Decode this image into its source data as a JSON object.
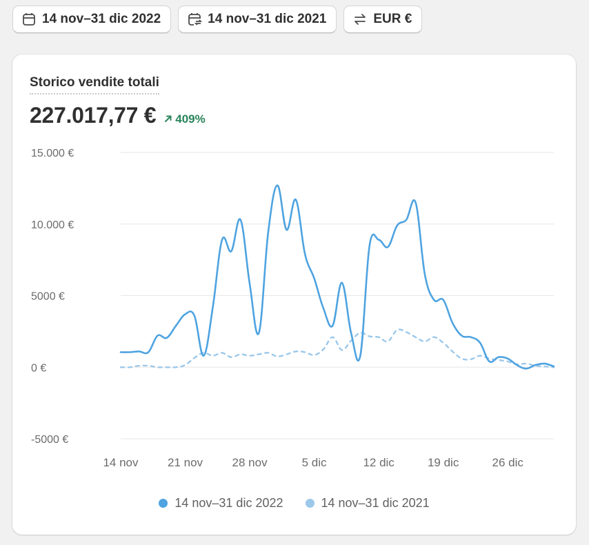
{
  "toolbar": {
    "date_range": "14 nov–31 dic 2022",
    "compare_range": "14 nov–31 dic 2021",
    "currency": "EUR €"
  },
  "card": {
    "title": "Storico vendite totali",
    "total": "227.017,77 €",
    "change": "409%"
  },
  "colors": {
    "primary": "#4ea3e0",
    "comparison": "#9cc8ea",
    "positive": "#29845a"
  },
  "chart_data": {
    "type": "line",
    "x_tick_labels": [
      "14 nov",
      "21 nov",
      "28 nov",
      "5 dic",
      "12 dic",
      "19 dic",
      "26 dic"
    ],
    "y_tick_labels": [
      "15.000 €",
      "10.000 €",
      "5000 €",
      "0 €",
      "-5000 €"
    ],
    "y_ticks": [
      15000,
      10000,
      5000,
      0,
      -5000
    ],
    "ylim": [
      -5000,
      15000
    ],
    "xlim": [
      0,
      47
    ],
    "grid": true,
    "legend_position": "bottom-center",
    "series": [
      {
        "name": "14 nov–31 dic 2022",
        "style": "solid",
        "x": [
          0,
          1,
          2,
          3,
          4,
          5,
          6,
          7,
          8,
          9,
          10,
          11,
          12,
          13,
          14,
          15,
          16,
          17,
          18,
          19,
          20,
          21,
          22,
          23,
          24,
          25,
          26,
          27,
          28,
          29,
          30,
          31,
          32,
          33,
          34,
          35,
          36,
          37,
          38,
          39,
          40,
          41,
          42,
          43,
          44,
          45,
          46,
          47
        ],
        "values": [
          1050,
          1050,
          1100,
          1050,
          2200,
          2050,
          2900,
          3700,
          3600,
          800,
          4200,
          8900,
          8100,
          10300,
          5800,
          2400,
          9400,
          12700,
          9600,
          11700,
          7900,
          6200,
          4100,
          2900,
          5900,
          2400,
          800,
          8500,
          8900,
          8400,
          9900,
          10300,
          11500,
          6500,
          4700,
          4700,
          3100,
          2200,
          2100,
          1700,
          400,
          700,
          600,
          150,
          -100,
          150,
          250,
          50
        ]
      },
      {
        "name": "14 nov–31 dic 2021",
        "style": "dashed",
        "x": [
          0,
          1,
          2,
          3,
          4,
          5,
          6,
          7,
          8,
          9,
          10,
          11,
          12,
          13,
          14,
          15,
          16,
          17,
          18,
          19,
          20,
          21,
          22,
          23,
          24,
          25,
          26,
          27,
          28,
          29,
          30,
          31,
          32,
          33,
          34,
          35,
          36,
          37,
          38,
          39,
          40,
          41,
          42,
          43,
          44,
          45,
          46,
          47
        ],
        "values": [
          0,
          0,
          100,
          100,
          0,
          0,
          0,
          150,
          650,
          1000,
          800,
          1000,
          700,
          900,
          800,
          900,
          1000,
          750,
          900,
          1100,
          1050,
          850,
          1250,
          2100,
          1200,
          1850,
          2400,
          2150,
          2100,
          1800,
          2600,
          2450,
          2100,
          1800,
          2100,
          1700,
          1100,
          600,
          550,
          800,
          600,
          500,
          400,
          200,
          250,
          100,
          50,
          0
        ]
      }
    ]
  }
}
